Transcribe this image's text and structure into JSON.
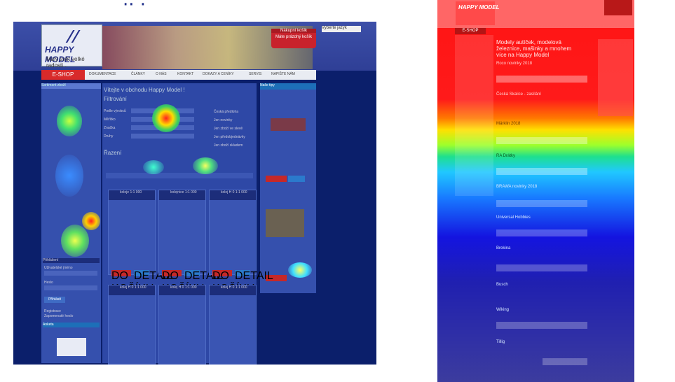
{
  "site": {
    "logo_text": "HAPPY MODEL",
    "slogan": "Malý svět velké radosti...",
    "cart_title": "Nákupní košík",
    "cart_empty": "Máte prázdný košík",
    "language_select": "Vyberte jazyk",
    "eshop_label": "E-SHOP",
    "nav": [
      "DOKUMENTACE",
      "ČLÁNKY",
      "O NÁS",
      "KONTAKT",
      "DOKAZY A CENÍKY",
      "SERVIS",
      "NAPIŠTE NÁM"
    ]
  },
  "left_panel": {
    "sidebar_heading": "Sortiment zboží",
    "page_title": "Vítejte v obchodu Happy Model !",
    "filter_title": "Filtrování",
    "filter_labels": [
      "Podle výrobců",
      "Měřítko",
      "Značka",
      "Druhy"
    ],
    "checkbox_labels": [
      "Česká předloha",
      "Jen novinky",
      "Jen zboží ve slevě",
      "Jen předobjednávky",
      "Jen zboží skladem"
    ],
    "sort_title": "Řazení",
    "right_box_title": "Naše tipy",
    "cards": [
      {
        "title": "koleje 1:1 000"
      },
      {
        "title": "kolejnice 1:1 000"
      },
      {
        "title": "kolej H 0 1:1 000"
      },
      {
        "title": "kolej H 0 1:1 000"
      },
      {
        "title": "kolej H 0 1:1 000"
      },
      {
        "title": "kolej H 0 1:1 000"
      }
    ],
    "card_buy": "DO KOŠÍKU",
    "card_detail": "DETAIL",
    "login_title": "Přihlášení",
    "login_username": "Uživatelské jméno",
    "login_password": "Heslo",
    "login_button": "Přihlásit",
    "register_link": "Registrace",
    "forgot_link": "Zapomenuté heslo",
    "poll_title": "Anketa"
  },
  "right_panel": {
    "eshop_label": "E-SHOP",
    "headline": "Modely autíček, modelová železnice, mašinky a mnohem více na Happy Model",
    "sections": [
      "Roco novinky 2018",
      "Česká Skalice - zasílání",
      "Märklin 2018",
      "RA Drátky",
      "BRAWA novinky 2018",
      "Universal Hobbies",
      "Brekina",
      "Busch",
      "Wiking",
      "Tillig"
    ]
  }
}
